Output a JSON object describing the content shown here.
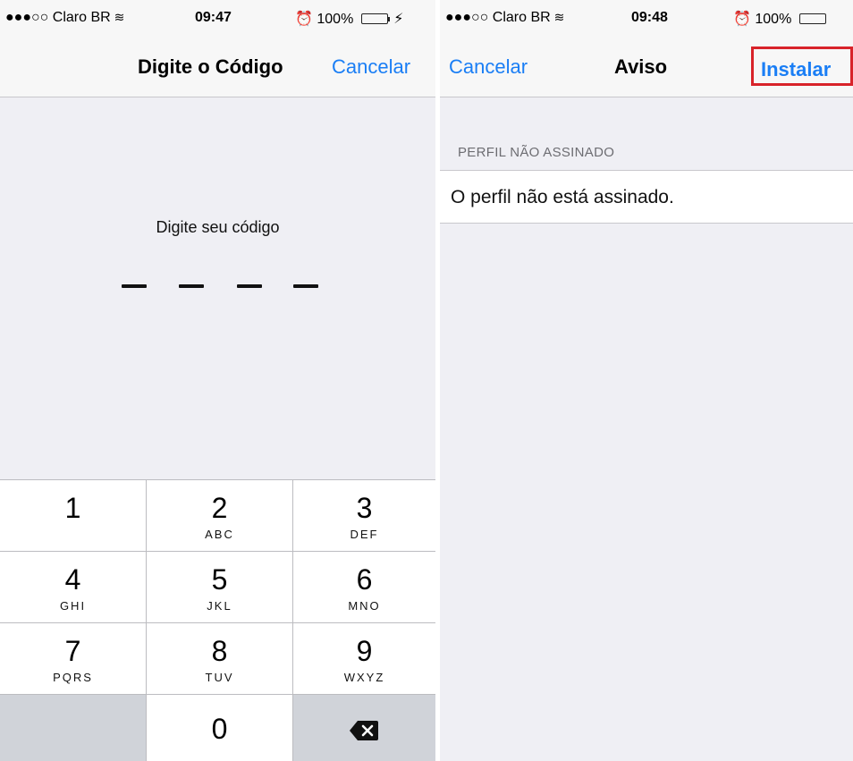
{
  "left": {
    "status": {
      "carrier": "●●●○○ Claro BR",
      "time": "09:47",
      "battery": "100%",
      "battery_level": 1.0
    },
    "nav": {
      "title": "Digite o Código",
      "cancel": "Cancelar"
    },
    "prompt": "Digite seu código",
    "keypad": [
      {
        "digit": "1",
        "letters": ""
      },
      {
        "digit": "2",
        "letters": "ABC"
      },
      {
        "digit": "3",
        "letters": "DEF"
      },
      {
        "digit": "4",
        "letters": "GHI"
      },
      {
        "digit": "5",
        "letters": "JKL"
      },
      {
        "digit": "6",
        "letters": "MNO"
      },
      {
        "digit": "7",
        "letters": "PQRS"
      },
      {
        "digit": "8",
        "letters": "TUV"
      },
      {
        "digit": "9",
        "letters": "WXYZ"
      },
      {
        "digit": "0",
        "letters": ""
      }
    ]
  },
  "right": {
    "status": {
      "carrier": "●●●○○ Claro BR",
      "time": "09:48",
      "battery": "100%",
      "battery_level": 1.0
    },
    "nav": {
      "cancel": "Cancelar",
      "title": "Aviso",
      "install": "Instalar"
    },
    "section_header": "PERFIL NÃO ASSINADO",
    "message": "O perfil não está assinado."
  },
  "colors": {
    "accent": "#1a7ef5",
    "highlight_box": "#d8232a",
    "battery": "#4cd964"
  },
  "icons": [
    "wifi-icon",
    "alarm-icon",
    "battery-icon",
    "charging-icon",
    "backspace-icon"
  ]
}
